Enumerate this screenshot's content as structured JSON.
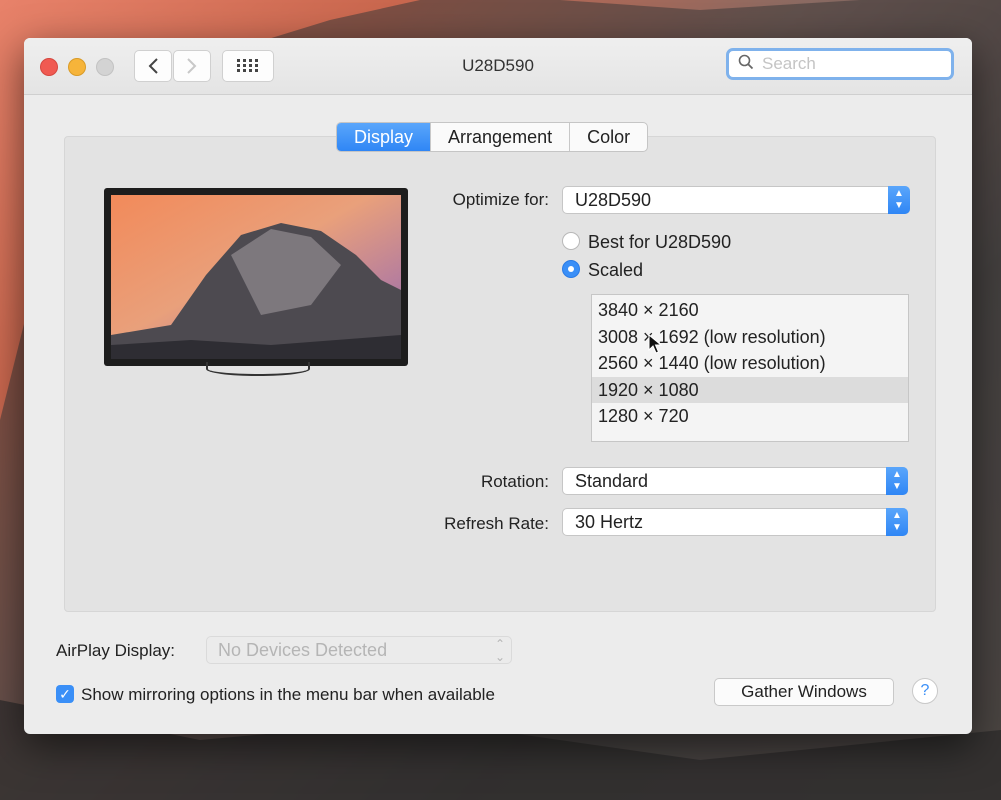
{
  "window": {
    "title": "U28D590"
  },
  "search": {
    "placeholder": "Search"
  },
  "tabs": [
    {
      "label": "Display",
      "active": true
    },
    {
      "label": "Arrangement",
      "active": false
    },
    {
      "label": "Color",
      "active": false
    }
  ],
  "optimize": {
    "label": "Optimize for:",
    "value": "U28D590"
  },
  "resolution_mode": {
    "best_label": "Best for U28D590",
    "scaled_label": "Scaled",
    "selected": "Scaled"
  },
  "resolutions": [
    {
      "label": "3840 × 2160",
      "selected": false
    },
    {
      "label": "3008 × 1692 (low resolution)",
      "selected": false
    },
    {
      "label": "2560 × 1440 (low resolution)",
      "selected": false
    },
    {
      "label": "1920 × 1080",
      "selected": true
    },
    {
      "label": "1280 × 720",
      "selected": false
    }
  ],
  "rotation": {
    "label": "Rotation:",
    "value": "Standard"
  },
  "refresh": {
    "label": "Refresh Rate:",
    "value": "30 Hertz"
  },
  "airplay": {
    "label": "AirPlay Display:",
    "value": "No Devices Detected"
  },
  "mirroring": {
    "label": "Show mirroring options in the menu bar when available",
    "checked": true
  },
  "buttons": {
    "gather": "Gather Windows",
    "help": "?"
  },
  "icons": {
    "back": "chevron-left-icon",
    "forward": "chevron-right-icon",
    "grid": "grid-icon",
    "search": "search-icon",
    "clear": "clear-icon",
    "check": "checkmark-icon"
  },
  "colors": {
    "accent": "#3a8ff7",
    "close": "#f05a52",
    "minimize": "#f6b43a"
  }
}
